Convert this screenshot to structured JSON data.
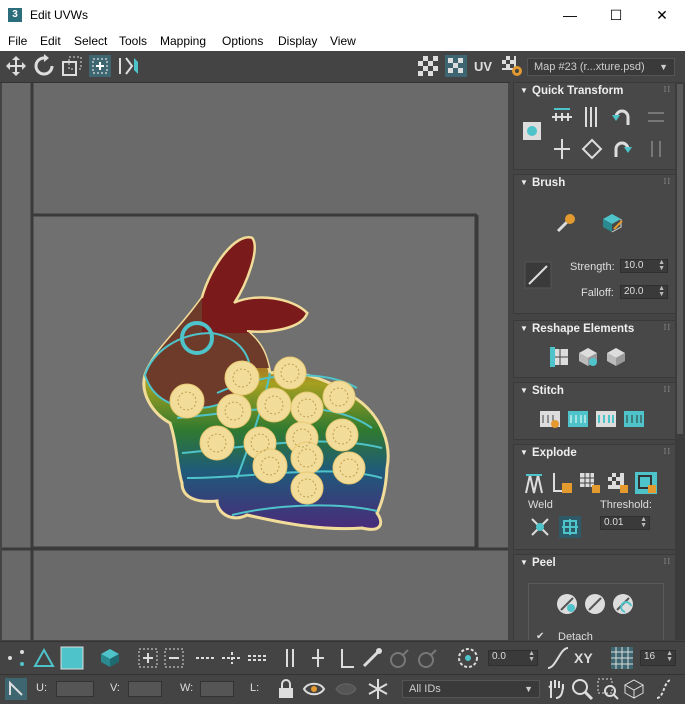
{
  "window": {
    "app_icon_text": "3",
    "title": "Edit UVWs",
    "minimize": "—",
    "maximize": "☐",
    "close": "✕"
  },
  "menu": [
    "File",
    "Edit",
    "Select",
    "Tools",
    "Mapping",
    "Options",
    "Display",
    "View"
  ],
  "toolbar": {
    "uv_label": "UV",
    "map_dropdown": "Map #23 (r...xture.psd)"
  },
  "panel": {
    "quick_transform": "Quick Transform",
    "brush": "Brush",
    "strength_label": "Strength:",
    "strength_value": "10.0",
    "falloff_label": "Falloff:",
    "falloff_value": "20.0",
    "reshape_elements": "Reshape Elements",
    "stitch": "Stitch",
    "explode": "Explode",
    "weld_label": "Weld",
    "threshold_label": "Threshold:",
    "threshold_value": "0.01",
    "peel": "Peel",
    "detach_label": "Detach",
    "detach_checked": true
  },
  "bottom": {
    "angle_value": "0.0",
    "xy_label": "XY",
    "grid_value": "16",
    "u_label": "U:",
    "v_label": "V:",
    "w_label": "W:",
    "l_label": "L:",
    "ids_dropdown": "All IDs"
  },
  "colors": {
    "accent": "#4ec3c9",
    "ui_bg": "#444444",
    "viewport_bg": "#6e6e6e"
  }
}
